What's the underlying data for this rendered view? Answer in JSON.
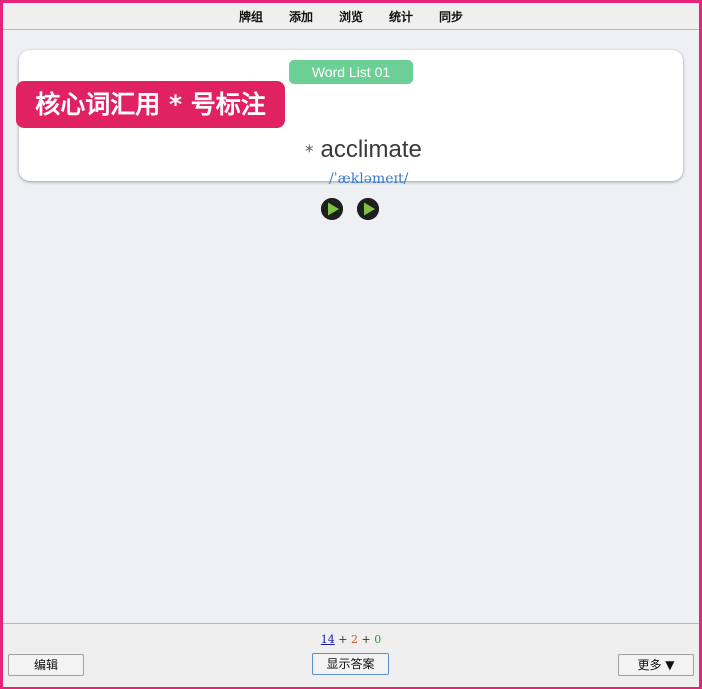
{
  "top_menu": {
    "items": [
      {
        "label": "牌组"
      },
      {
        "label": "添加"
      },
      {
        "label": "浏览"
      },
      {
        "label": "统计"
      },
      {
        "label": "同步"
      }
    ]
  },
  "card": {
    "deck_name": "Word List 01",
    "overlay_banner": "核心词汇用 * 号标注",
    "core_mark": "*",
    "word": "acclimate",
    "phonetic": "/ˈækləmeɪt/",
    "audio_buttons": [
      {
        "icon": "play-icon"
      },
      {
        "icon": "play-icon"
      }
    ]
  },
  "bottom_bar": {
    "counts": {
      "new": "14",
      "sep1": "+",
      "learning": "2",
      "sep2": "+",
      "review": "0"
    },
    "edit_label": "编辑",
    "show_answer_label": "显示答案",
    "more_label": "更多 ▼"
  },
  "colors": {
    "frame_border": "#e6247a",
    "banner": "#e02262",
    "deck_pill": "#6ccf95",
    "phonetic": "#3a78c9",
    "play_icon": "#7dc242",
    "count_new": "#1a1aa6",
    "count_learning": "#c35617",
    "count_review": "#2a9a2a"
  }
}
